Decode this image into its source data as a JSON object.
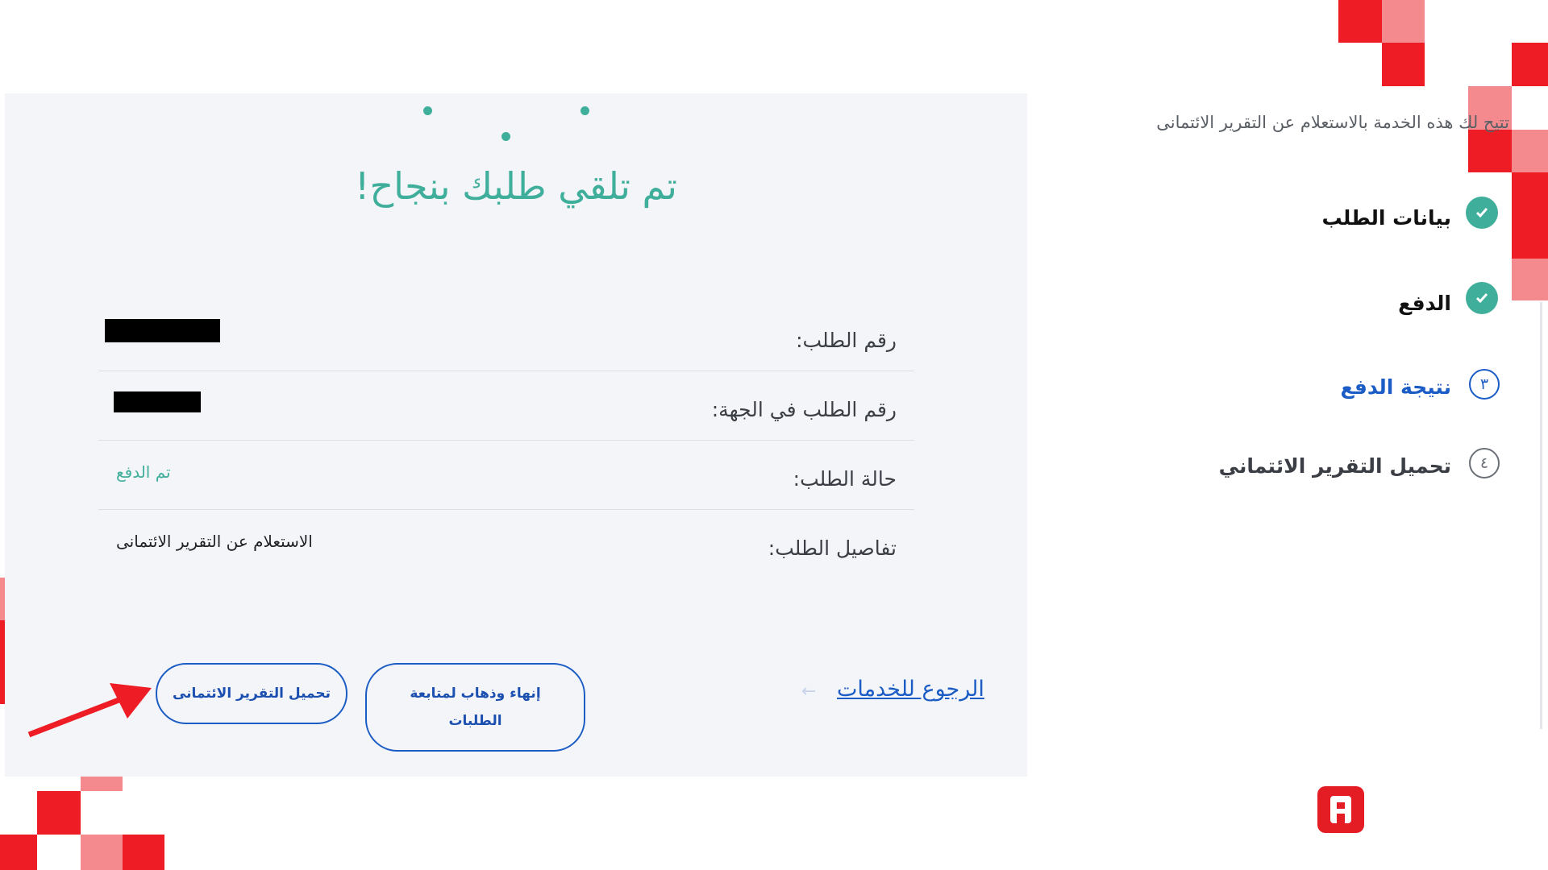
{
  "card": {
    "title": "تم تلقي طلبك بنجاح!",
    "details": [
      {
        "label": "رقم الطلب:",
        "value": ""
      },
      {
        "label": "رقم الطلب في الجهة:",
        "value": ""
      },
      {
        "label": "حالة الطلب:",
        "value": "تم الدفع"
      },
      {
        "label": "تفاصيل الطلب:",
        "value": "الاستعلام عن التقرير الائتمانى"
      }
    ],
    "buttons": {
      "download": "تحميل التقرير الائتمانى",
      "finish": "إنهاء وذهاب لمتابعة الطلبات"
    },
    "back_link": "الرجوع للخدمات"
  },
  "sidebar": {
    "intro": "تتيح لك هذه الخدمة بالاستعلام عن التقرير الائتمانى",
    "steps": [
      {
        "label": "بيانات الطلب",
        "state": "done"
      },
      {
        "label": "الدفع",
        "state": "done"
      },
      {
        "label": "نتيجة الدفع",
        "number": "٣",
        "state": "current"
      },
      {
        "label": "تحميل التقرير الائتماني",
        "number": "٤",
        "state": "pending"
      }
    ]
  },
  "colors": {
    "accent_green": "#3fae9b",
    "link_blue": "#1b5cc5",
    "brand_red": "#ee1c25",
    "brand_pink": "#f48a8d",
    "card_bg": "#f3f5f8"
  },
  "icons": [
    "check-icon",
    "arrow-left-icon",
    "red-annotation-arrow",
    "brand-logo-icon"
  ]
}
